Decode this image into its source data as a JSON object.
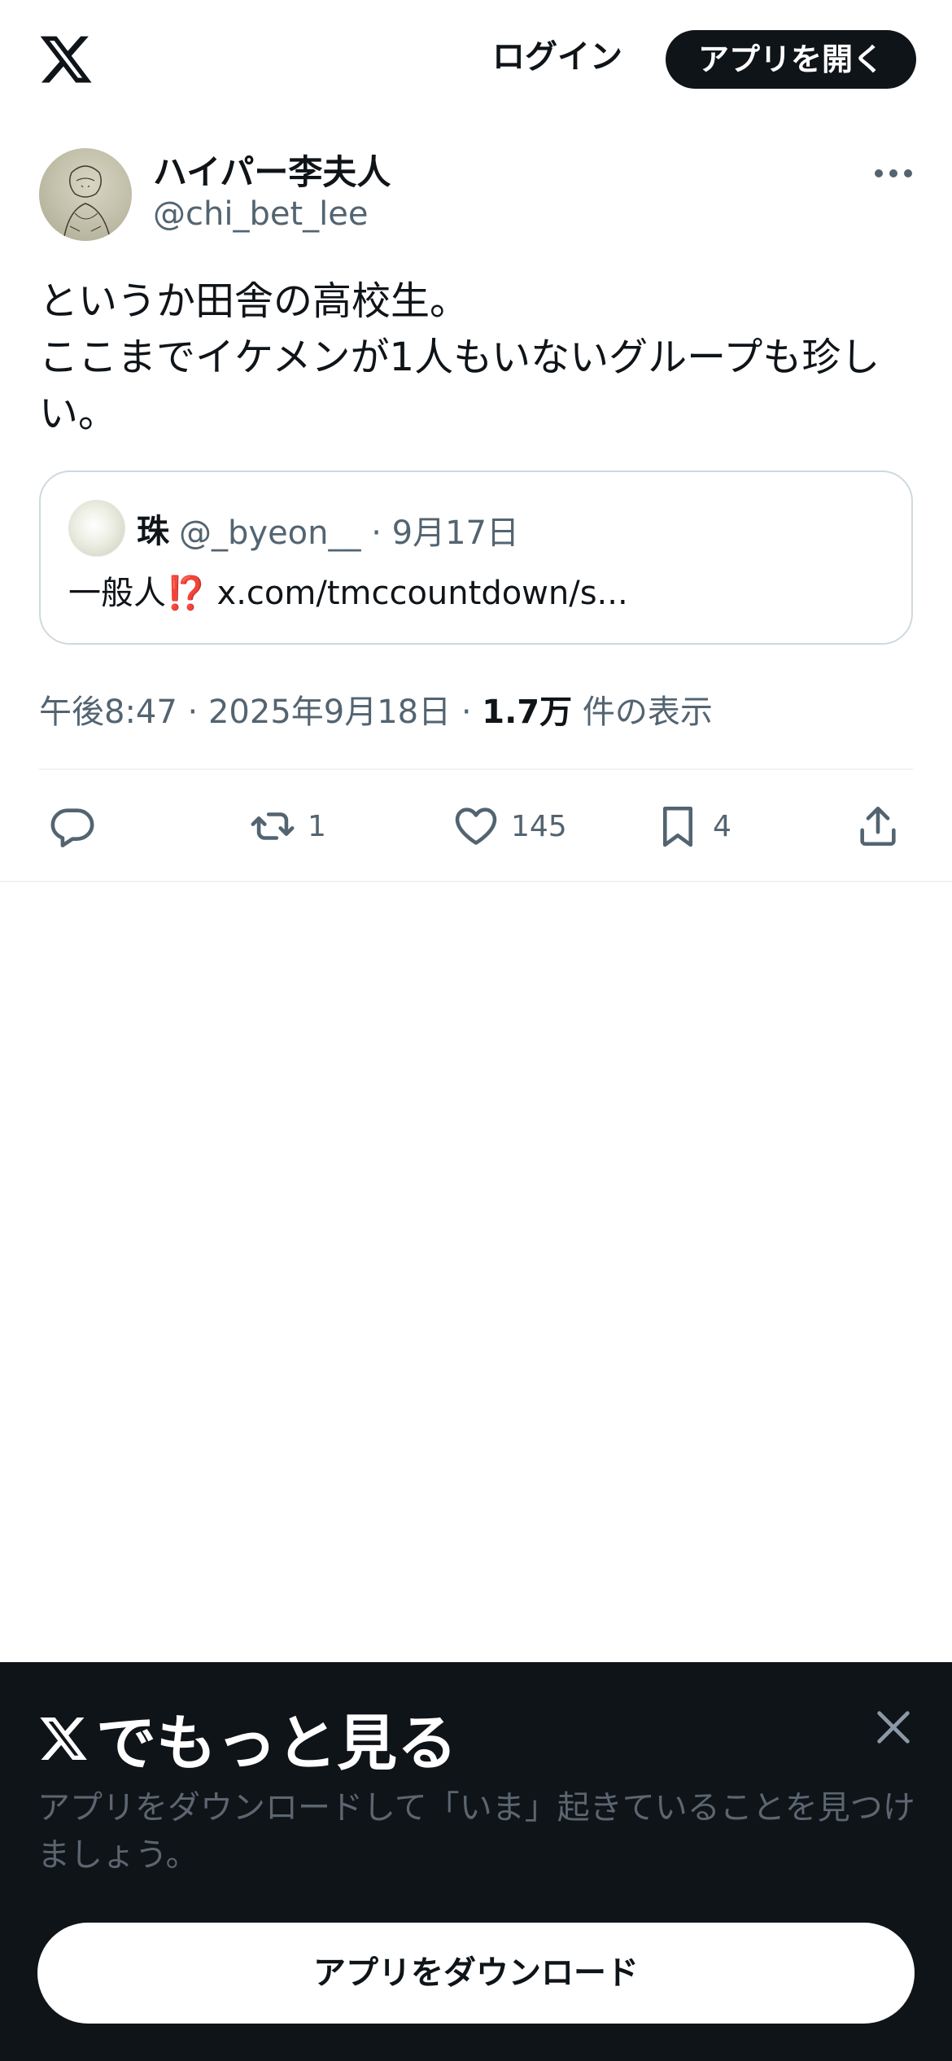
{
  "header": {
    "logo_icon": "x-logo-icon",
    "login_label": "ログイン",
    "open_app_label": "アプリを開く"
  },
  "tweet": {
    "display_name": "ハイパー李夫人",
    "handle": "@chi_bet_lee",
    "text": "というか田舎の高校生。\nここまでイケメンが1人もいないグループも珍しい。",
    "quote": {
      "name": "珠",
      "handle_date": "@_byeon__ · 9月17日",
      "body_text": "一般人",
      "body_emoji": "⁉️",
      "body_link": " x.com/tmccountdown/s..."
    },
    "meta": {
      "time_date": "午後8:47 · 2025年9月18日 · ",
      "views_count": "1.7万",
      "views_label": " 件の表示"
    },
    "actions": {
      "reply_icon": "reply-icon",
      "retweet_icon": "retweet-icon",
      "retweet_count": "1",
      "like_icon": "heart-icon",
      "like_count": "145",
      "bookmark_icon": "bookmark-icon",
      "bookmark_count": "4",
      "share_icon": "share-icon"
    }
  },
  "sheet": {
    "title": "でもっと見る",
    "description": "アプリをダウンロードして「いま」起きていることを見つけましょう。",
    "download_label": "アプリをダウンロード",
    "close_icon": "close-icon"
  },
  "colors": {
    "text_primary": "#0f1419",
    "text_secondary": "#536471",
    "border": "#cfd9de",
    "sheet_bg": "#0f1419",
    "emoji_red": "#d0213c"
  }
}
